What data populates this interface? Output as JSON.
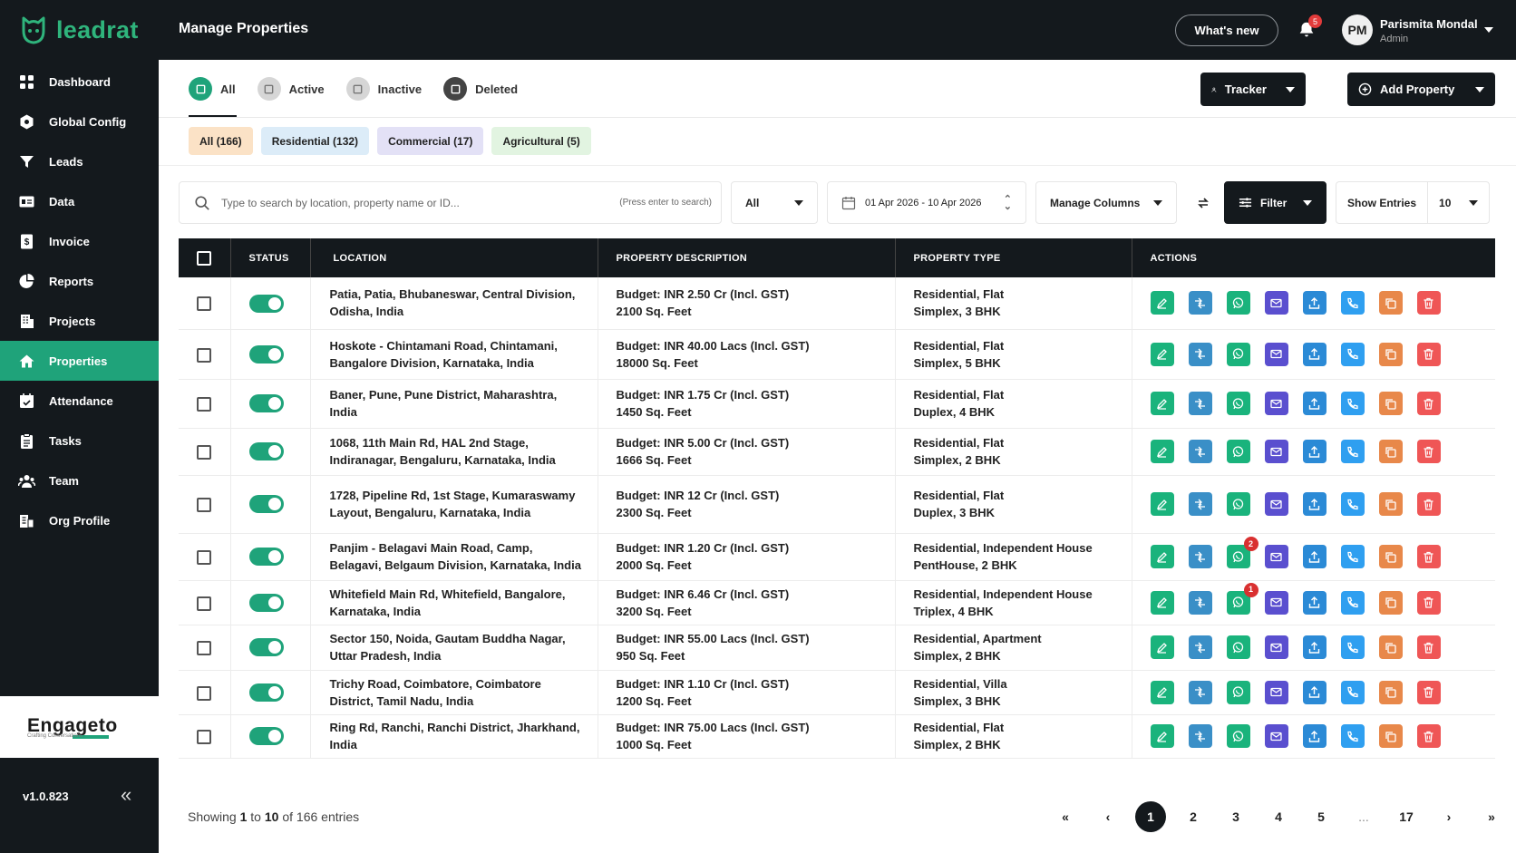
{
  "app": {
    "name": "leadrat",
    "version": "v1.0.823"
  },
  "brand": {
    "name": "Engageto",
    "tagline": "Crafting Conversations"
  },
  "sidebar": {
    "items": [
      {
        "label": "Dashboard",
        "icon": "grid-icon"
      },
      {
        "label": "Global Config",
        "icon": "hexagon-icon"
      },
      {
        "label": "Leads",
        "icon": "funnel-icon"
      },
      {
        "label": "Data",
        "icon": "id-card-icon"
      },
      {
        "label": "Invoice",
        "icon": "invoice-icon"
      },
      {
        "label": "Reports",
        "icon": "pie-chart-icon"
      },
      {
        "label": "Projects",
        "icon": "building-icon"
      },
      {
        "label": "Properties",
        "icon": "home-icon",
        "active": true
      },
      {
        "label": "Attendance",
        "icon": "calendar-check-icon"
      },
      {
        "label": "Tasks",
        "icon": "clipboard-icon"
      },
      {
        "label": "Team",
        "icon": "users-icon"
      },
      {
        "label": "Org Profile",
        "icon": "org-icon"
      }
    ]
  },
  "header": {
    "title": "Manage Properties",
    "whats_new": "What's new",
    "notification_count": "5",
    "user": {
      "initials": "PM",
      "name": "Parismita Mondal",
      "role": "Admin"
    }
  },
  "status_tabs": [
    {
      "label": "All",
      "active": true
    },
    {
      "label": "Active"
    },
    {
      "label": "Inactive"
    },
    {
      "label": "Deleted"
    }
  ],
  "buttons": {
    "tracker": "Tracker",
    "add_property": "Add Property"
  },
  "category_chips": [
    {
      "label": "All (166)",
      "color": "#fbe2c6"
    },
    {
      "label": "Residential (132)",
      "color": "#dcecf8"
    },
    {
      "label": "Commercial (17)",
      "color": "#e3e1f6"
    },
    {
      "label": "Agricultural (5)",
      "color": "#e2f4e1"
    }
  ],
  "filters": {
    "search_placeholder": "Type to search by location, property name or ID...",
    "search_hint": "(Press enter to search)",
    "type_select": "All",
    "date_range": "01 Apr 2026 - 10 Apr 2026",
    "manage_columns": "Manage Columns",
    "filter": "Filter",
    "show_entries_label": "Show Entries",
    "show_entries_value": "10"
  },
  "table": {
    "columns": [
      "STATUS",
      "LOCATION",
      "PROPERTY DESCRIPTION",
      "PROPERTY TYPE",
      "ACTIONS"
    ],
    "rows": [
      {
        "location": "Patia, Patia, Bhubaneswar, Central Division, Odisha, India",
        "budget": "Budget: INR 2.50 Cr (Incl. GST)",
        "area": "2100 Sq. Feet",
        "type": "Residential, Flat",
        "sub": "Simplex, 3 BHK",
        "wa": ""
      },
      {
        "location": "Hoskote - Chintamani Road, Chintamani, Bangalore Division, Karnataka, India",
        "budget": "Budget: INR 40.00 Lacs (Incl. GST)",
        "area": "18000 Sq. Feet",
        "type": "Residential, Flat",
        "sub": "Simplex, 5 BHK",
        "wa": ""
      },
      {
        "location": "Baner, Pune, Pune District, Maharashtra, India",
        "budget": "Budget: INR 1.75 Cr (Incl. GST)",
        "area": "1450 Sq. Feet",
        "type": "Residential, Flat",
        "sub": "Duplex, 4 BHK",
        "wa": ""
      },
      {
        "location": "1068, 11th Main Rd, HAL 2nd Stage, Indiranagar, Bengaluru, Karnataka, India",
        "budget": "Budget: INR 5.00 Cr (Incl. GST)",
        "area": "1666 Sq. Feet",
        "type": "Residential, Flat",
        "sub": "Simplex, 2 BHK",
        "wa": ""
      },
      {
        "location": "1728, Pipeline Rd, 1st Stage, Kumaraswamy Layout, Bengaluru, Karnataka, India",
        "budget": "Budget: INR 12 Cr (Incl. GST)",
        "area": "2300 Sq. Feet",
        "type": "Residential, Flat",
        "sub": "Duplex, 3 BHK",
        "wa": ""
      },
      {
        "location": "Panjim - Belagavi Main Road, Camp, Belagavi, Belgaum Division, Karnataka, India",
        "budget": "Budget: INR 1.20 Cr (Incl. GST)",
        "area": "2000 Sq. Feet",
        "type": "Residential, Independent House",
        "sub": "PentHouse, 2 BHK",
        "wa": "2"
      },
      {
        "location": "Whitefield Main Rd, Whitefield, Bangalore, Karnataka, India",
        "budget": "Budget: INR 6.46 Cr (Incl. GST)",
        "area": "3200 Sq. Feet",
        "type": "Residential, Independent House",
        "sub": "Triplex, 4 BHK",
        "wa": "1"
      },
      {
        "location": "Sector 150, Noida, Gautam Buddha Nagar, Uttar Pradesh, India",
        "budget": "Budget: INR 55.00 Lacs (Incl. GST)",
        "area": "950 Sq. Feet",
        "type": "Residential, Apartment",
        "sub": "Simplex, 2 BHK",
        "wa": ""
      },
      {
        "location": "Trichy Road, Coimbatore, Coimbatore District, Tamil Nadu, India",
        "budget": "Budget: INR 1.10 Cr (Incl. GST)",
        "area": "1200 Sq. Feet",
        "type": "Residential, Villa",
        "sub": "Simplex, 3 BHK",
        "wa": ""
      },
      {
        "location": "Ring Rd, Ranchi, Ranchi District, Jharkhand, India",
        "budget": "Budget: INR 75.00 Lacs (Incl. GST)",
        "area": "1000 Sq. Feet",
        "type": "Residential, Flat",
        "sub": "Simplex, 2 BHK",
        "wa": ""
      }
    ],
    "actions": [
      {
        "name": "edit-icon",
        "color": "#1ab37c"
      },
      {
        "name": "assign-icon",
        "color": "#3a8fc7"
      },
      {
        "name": "whatsapp-icon",
        "color": "#1ab37c"
      },
      {
        "name": "mail-icon",
        "color": "#5a4fcf"
      },
      {
        "name": "share-icon",
        "color": "#2b8ad6"
      },
      {
        "name": "phone-icon",
        "color": "#2f9ff0"
      },
      {
        "name": "copy-icon",
        "color": "#e8884a"
      },
      {
        "name": "delete-icon",
        "color": "#ef5656"
      }
    ]
  },
  "pagination": {
    "showing_prefix": "Showing",
    "from": "1",
    "to_word": "to",
    "to": "10",
    "of_word": "of",
    "total": "166",
    "suffix": "entries",
    "pages": [
      "1",
      "2",
      "3",
      "4",
      "5",
      "...",
      "17"
    ],
    "current": "1"
  },
  "colors": {
    "sidebar_bg": "#14191d",
    "accent": "#1fa37a"
  }
}
